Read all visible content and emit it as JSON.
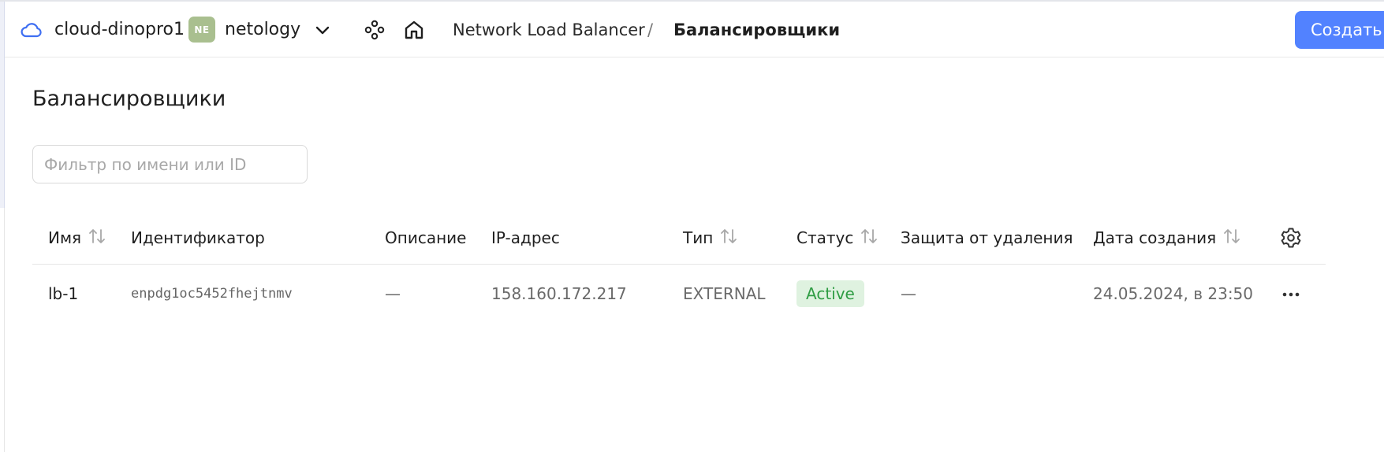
{
  "header": {
    "cloud_name": "cloud-dinopro1",
    "folder_avatar": "NE",
    "folder_name": "netology",
    "breadcrumb": [
      "Network Load Balancer",
      "/",
      "Балансировщики"
    ],
    "create_label": "Создать"
  },
  "icons": [
    "cloud-icon",
    "chevron-down-icon",
    "services-icon",
    "home-icon",
    "sort-icon",
    "gear-icon",
    "more-icon"
  ],
  "page": {
    "title": "Балансировщики",
    "filter_placeholder": "Фильтр по имени или ID"
  },
  "table": {
    "columns": [
      "Имя",
      "Идентификатор",
      "Описание",
      "IP-адрес",
      "Тип",
      "Статус",
      "Защита от удаления",
      "Дата создания"
    ],
    "rows": [
      {
        "name": "lb-1",
        "id": "enpdg1oc5452fhejtnmv",
        "description": "—",
        "ip": "158.160.172.217",
        "type": "EXTERNAL",
        "status": "Active",
        "deletion_protection": "—",
        "created": "24.05.2024, в 23:50"
      }
    ]
  },
  "colors": {
    "accent": "#5282ff",
    "status_active_bg": "#dff2e0",
    "status_active_text": "#2f9d44",
    "folder_avatar_bg": "#a9bf8f"
  }
}
